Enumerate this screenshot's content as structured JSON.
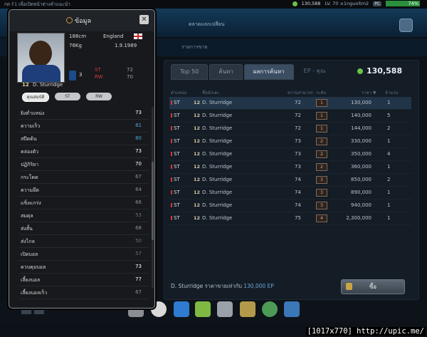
{
  "topbar": {
    "hint": "กด F1 เพื่อเปิดหน้าต่างคำแนะนำ",
    "ep_value": "130,588",
    "level": "LV. 70 ±1nguoltm2",
    "pc_label": "PC",
    "progress_label": "74%",
    "progress": 0.74
  },
  "banner": {
    "title": "ตลาดแลกเปลี่ยน",
    "subnav_label": "รายการขาย"
  },
  "market": {
    "tabs": [
      "Top 50",
      "ค้นหา",
      "ผลการค้นหา",
      "EP - คุณ"
    ],
    "ep_total": "130,588",
    "columns": [
      "ตำแหน่ง",
      "ชื่อนักเตะ",
      "ความสามารถ",
      "ระดับ",
      "ราคา ▼",
      "จำนวน"
    ],
    "rows": [
      {
        "pos": "ST",
        "num": "12",
        "name": "D. Sturridge",
        "ovr": "72",
        "grade": "1",
        "price": "130,000",
        "qty": "1"
      },
      {
        "pos": "ST",
        "num": "12",
        "name": "D. Sturridge",
        "ovr": "72",
        "grade": "1",
        "price": "140,000",
        "qty": "5"
      },
      {
        "pos": "ST",
        "num": "12",
        "name": "D. Sturridge",
        "ovr": "72",
        "grade": "1",
        "price": "144,000",
        "qty": "2"
      },
      {
        "pos": "ST",
        "num": "12",
        "name": "D. Sturridge",
        "ovr": "73",
        "grade": "2",
        "price": "330,000",
        "qty": "1"
      },
      {
        "pos": "ST",
        "num": "12",
        "name": "D. Sturridge",
        "ovr": "73",
        "grade": "2",
        "price": "350,000",
        "qty": "4"
      },
      {
        "pos": "ST",
        "num": "12",
        "name": "D. Sturridge",
        "ovr": "73",
        "grade": "2",
        "price": "360,000",
        "qty": "1"
      },
      {
        "pos": "ST",
        "num": "12",
        "name": "D. Sturridge",
        "ovr": "74",
        "grade": "3",
        "price": "850,000",
        "qty": "2"
      },
      {
        "pos": "ST",
        "num": "12",
        "name": "D. Sturridge",
        "ovr": "74",
        "grade": "3",
        "price": "890,000",
        "qty": "1"
      },
      {
        "pos": "ST",
        "num": "12",
        "name": "D. Sturridge",
        "ovr": "74",
        "grade": "3",
        "price": "940,000",
        "qty": "1"
      },
      {
        "pos": "ST",
        "num": "12",
        "name": "D. Sturridge",
        "ovr": "75",
        "grade": "4",
        "price": "2,300,000",
        "qty": "1"
      }
    ],
    "price_note_prefix": "D. Sturridge ราคาขายเท่ากับ",
    "price_note_value": "130,000 EP",
    "buy_label": "ซื้อ"
  },
  "popup": {
    "title": "ข้อมูล",
    "close": "✕",
    "height": "188cm",
    "weight": "76Kg",
    "nation": "England",
    "dob": "1.9.1989",
    "player_num": "12",
    "player_name": "D. Sturridge",
    "card_level": "3",
    "positions": [
      {
        "pos": "ST",
        "ovr": "72"
      },
      {
        "pos": "RW",
        "ovr": "70"
      }
    ],
    "tabs": [
      "คุณสมบัติ",
      "ST",
      "RW"
    ],
    "stats": [
      {
        "label": "ยิงต่ำแหน่ง",
        "value": "73",
        "color": "#ffffff"
      },
      {
        "label": "ความเร็ว",
        "value": "81",
        "color": "#4fa6e0"
      },
      {
        "label": "สปีดต้น",
        "value": "80",
        "color": "#4fa6e0"
      },
      {
        "label": "คล่องตัว",
        "value": "73",
        "color": "#ffffff"
      },
      {
        "label": "ปฏิกิริยา",
        "value": "70",
        "color": "#ffffff"
      },
      {
        "label": "กระโดด",
        "value": "67",
        "color": "#8a8f96"
      },
      {
        "label": "ความอึด",
        "value": "64",
        "color": "#8a8f96"
      },
      {
        "label": "แข็งแกร่ง",
        "value": "66",
        "color": "#8a8f96"
      },
      {
        "label": "สมดุล",
        "value": "53",
        "color": "#6b7076"
      },
      {
        "label": "ส่งสั้น",
        "value": "68",
        "color": "#8a8f96"
      },
      {
        "label": "ส่งไกล",
        "value": "50",
        "color": "#6b7076"
      },
      {
        "label": "เปิดบอล",
        "value": "57",
        "color": "#6b7076"
      },
      {
        "label": "ควบคุมบอล",
        "value": "73",
        "color": "#ffffff"
      },
      {
        "label": "เลี้ยงบอล",
        "value": "77",
        "color": "#ffffff"
      },
      {
        "label": "เลี้ยงบอลเร็ว",
        "value": "67",
        "color": "#8a8f96"
      }
    ]
  },
  "footer": "[1017x770] http://upic.me/"
}
